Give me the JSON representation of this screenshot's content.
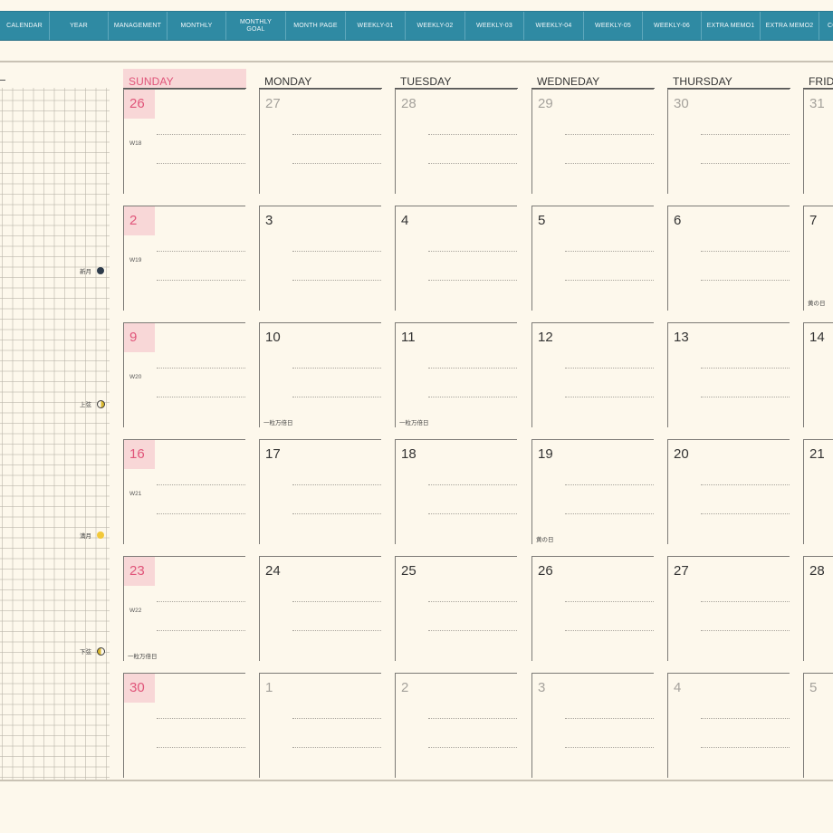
{
  "tabs": [
    "CALENDAR",
    "YEAR",
    "MANAGEMENT",
    "MONTHLY",
    "MONTHLY GOAL",
    "MONTH PAGE",
    "WEEKLY-01",
    "WEEKLY-02",
    "WEEKLY-03",
    "WEEKLY-04",
    "WEEKLY-05",
    "WEEKLY-06",
    "EXTRA MEMO1",
    "EXTRA MEMO2",
    "CO"
  ],
  "days": [
    "SUNDAY",
    "MONDAY",
    "TUESDAY",
    "WEDNEDAY",
    "THURSDAY",
    "FRIDAY"
  ],
  "colors": {
    "tabbar": "#2f8aa3",
    "sunday_accent": "#e0557a",
    "sunday_bg": "#f8d7d7",
    "page_bg": "#fdf8ec"
  },
  "weeks": [
    {
      "label": "W18",
      "dates": [
        "26",
        "27",
        "28",
        "29",
        "30",
        "31"
      ],
      "dim": [
        true,
        true,
        true,
        true,
        true,
        true
      ],
      "notes": [
        "",
        "",
        "",
        "",
        "",
        ""
      ]
    },
    {
      "label": "W19",
      "dates": [
        "2",
        "3",
        "4",
        "5",
        "6",
        "7"
      ],
      "dim": [
        false,
        false,
        false,
        false,
        false,
        false
      ],
      "notes": [
        "",
        "",
        "",
        "",
        "",
        "黄の日"
      ]
    },
    {
      "label": "W20",
      "dates": [
        "9",
        "10",
        "11",
        "12",
        "13",
        "14"
      ],
      "dim": [
        false,
        false,
        false,
        false,
        false,
        false
      ],
      "notes": [
        "",
        "一粒万倍日",
        "一粒万倍日",
        "",
        "",
        ""
      ]
    },
    {
      "label": "W21",
      "dates": [
        "16",
        "17",
        "18",
        "19",
        "20",
        "21"
      ],
      "dim": [
        false,
        false,
        false,
        false,
        false,
        false
      ],
      "notes": [
        "",
        "",
        "",
        "黄の日",
        "",
        ""
      ]
    },
    {
      "label": "W22",
      "dates": [
        "23",
        "24",
        "25",
        "26",
        "27",
        "28"
      ],
      "dim": [
        false,
        false,
        false,
        false,
        false,
        false
      ],
      "notes": [
        "一粒万倍日",
        "",
        "",
        "",
        "",
        ""
      ]
    },
    {
      "label": "",
      "dates": [
        "30",
        "1",
        "2",
        "3",
        "4",
        "5"
      ],
      "dim": [
        false,
        true,
        true,
        true,
        true,
        true
      ],
      "notes": [
        "",
        "",
        "",
        "",
        "",
        ""
      ]
    }
  ],
  "moon_phases": [
    {
      "label": "新月",
      "icon": "new-moon-icon"
    },
    {
      "label": "上弦",
      "icon": "first-quarter-moon-icon"
    },
    {
      "label": "満月",
      "icon": "full-moon-icon"
    },
    {
      "label": "下弦",
      "icon": "last-quarter-moon-icon"
    }
  ]
}
